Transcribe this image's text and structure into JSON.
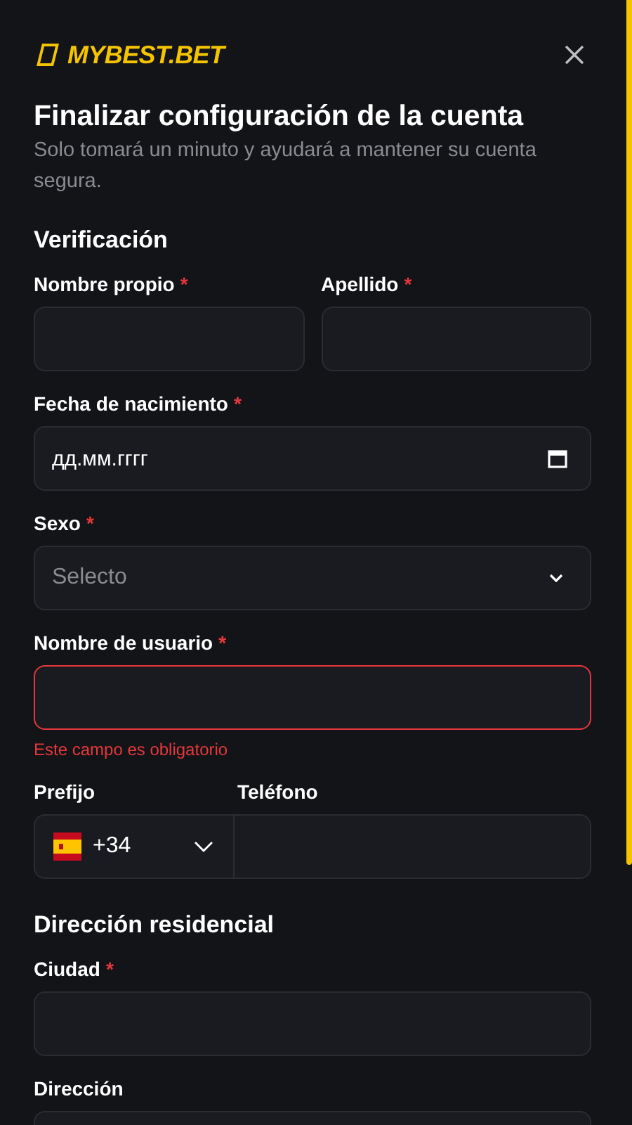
{
  "header": {
    "logo": "MYBEST.BET"
  },
  "title": "Finalizar configuración de la cuenta",
  "subtitle": "Solo tomará un minuto y ayudará a mantener su cuenta segura.",
  "sections": [
    {
      "heading": "Verificación",
      "rows": [
        [
          {
            "kind": "text",
            "label": "Nombre propio",
            "required_mark": "*"
          },
          {
            "kind": "text",
            "label": "Apellido",
            "required_mark": "*"
          }
        ],
        [
          {
            "kind": "date",
            "label": "Fecha de nacimiento",
            "required_mark": "*",
            "placeholder": "дд.мм.гггг"
          }
        ],
        [
          {
            "kind": "select",
            "label": "Sexo",
            "required_mark": "*",
            "placeholder": "Selecto"
          }
        ],
        [
          {
            "kind": "text",
            "label": "Nombre de usuario",
            "required_mark": "*",
            "error": "Este campo es obligatorio"
          }
        ],
        [
          {
            "kind": "phone",
            "label": "Prefijo",
            "phone_label": "Teléfono",
            "prefix": "+34"
          }
        ]
      ]
    },
    {
      "heading": "Dirección residencial",
      "rows": [
        [
          {
            "kind": "text",
            "label": "Ciudad",
            "required_mark": "*"
          }
        ],
        [
          {
            "kind": "text",
            "label": "Dirección"
          }
        ]
      ]
    }
  ]
}
